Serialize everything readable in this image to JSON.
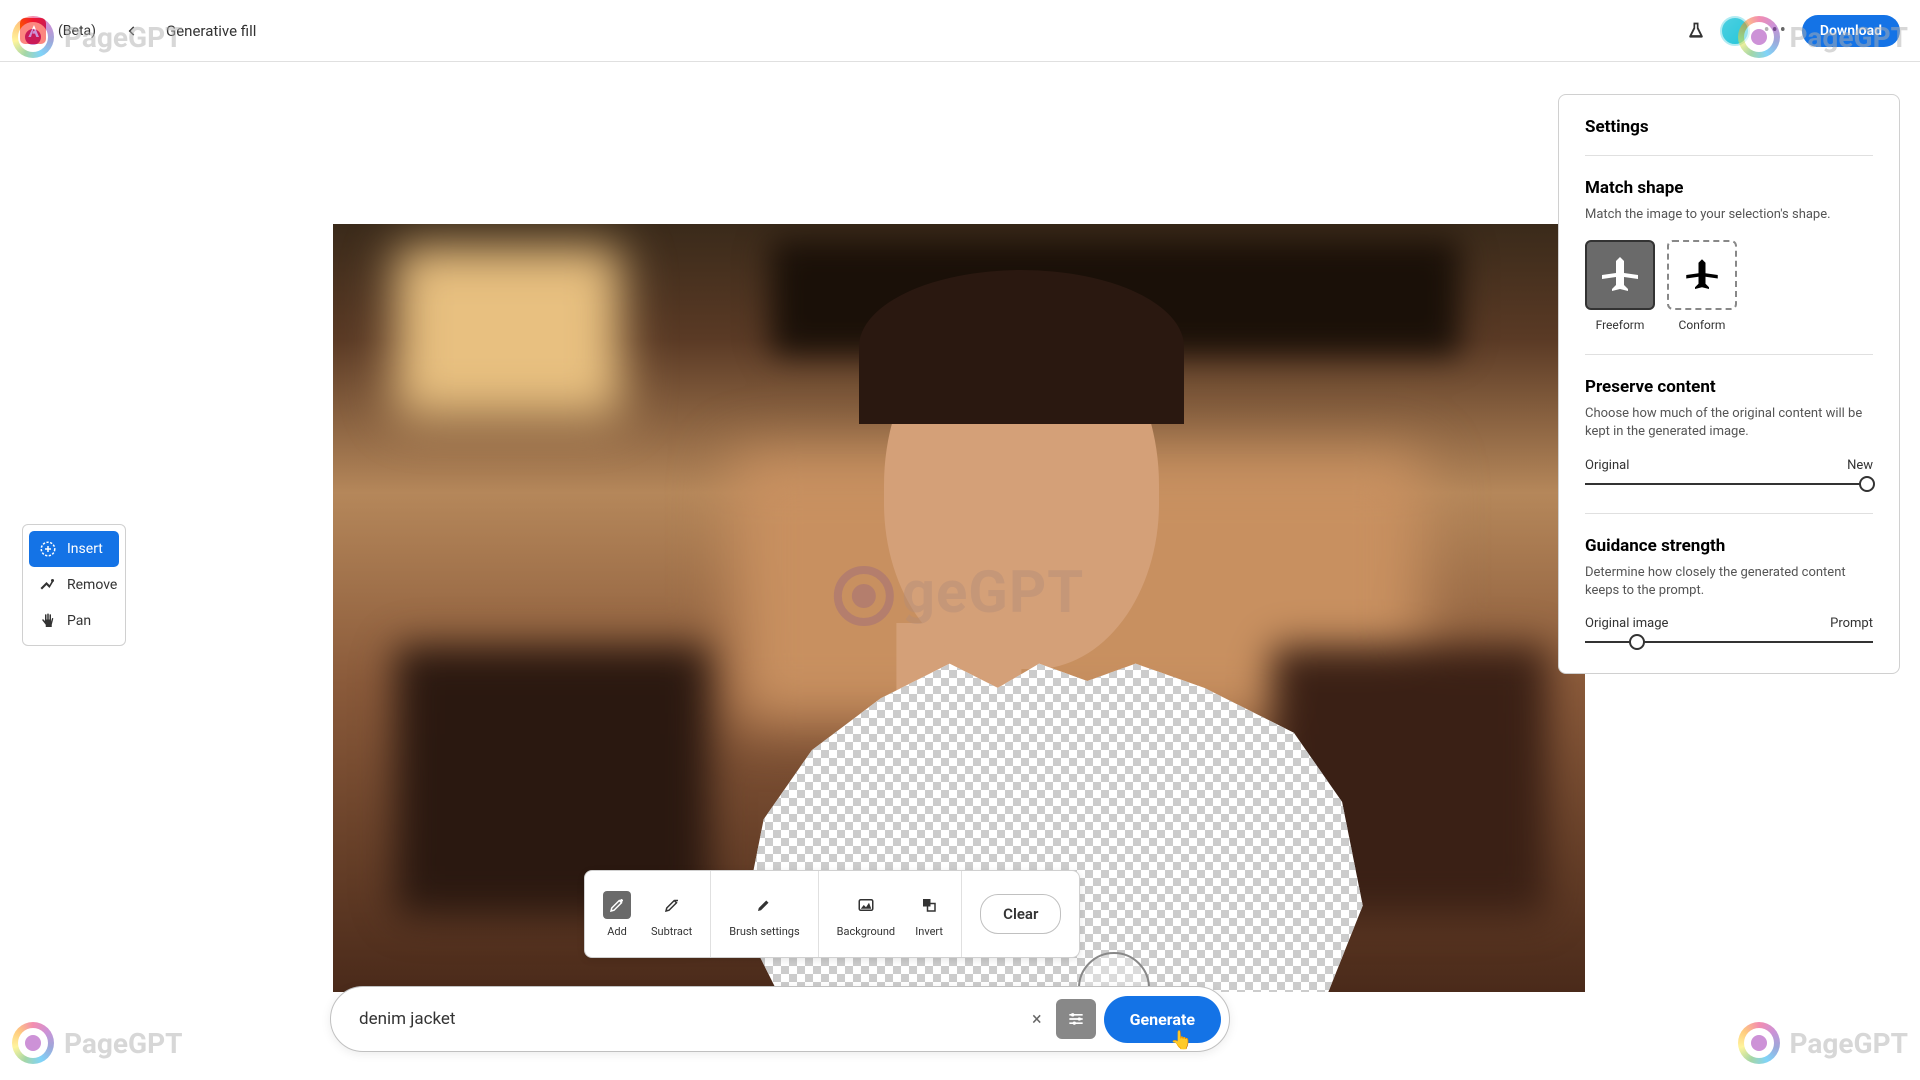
{
  "header": {
    "beta": "(Beta)",
    "title": "Generative fill",
    "download": "Download"
  },
  "leftTools": {
    "insert": "Insert",
    "remove": "Remove",
    "pan": "Pan"
  },
  "brushTools": {
    "add": "Add",
    "subtract": "Subtract",
    "brushSettings": "Brush settings",
    "background": "Background",
    "invert": "Invert",
    "clear": "Clear"
  },
  "prompt": {
    "value": "denim jacket",
    "generate": "Generate"
  },
  "settings": {
    "title": "Settings",
    "matchShape": {
      "title": "Match shape",
      "desc": "Match the image to your selection's shape.",
      "freeform": "Freeform",
      "conform": "Conform"
    },
    "preserve": {
      "title": "Preserve content",
      "desc": "Choose how much of the original content will be kept in the generated image.",
      "left": "Original",
      "right": "New"
    },
    "guidance": {
      "title": "Guidance strength",
      "desc": "Determine how closely the generated content keeps to the prompt.",
      "left": "Original image",
      "right": "Prompt"
    }
  },
  "watermark": {
    "center": "geGPT",
    "corner": "PageGPT"
  }
}
